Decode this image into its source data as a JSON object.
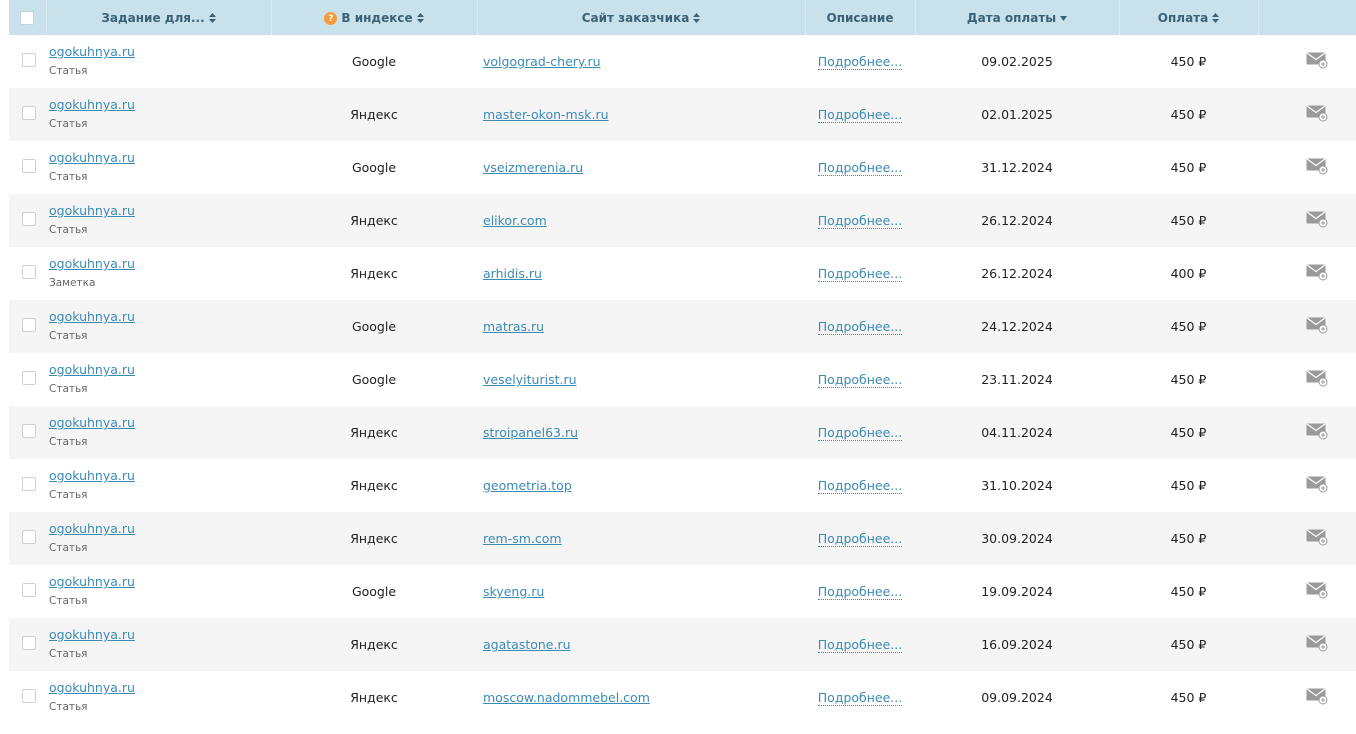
{
  "header": {
    "task": "Задание для...",
    "index": "В индексе",
    "index_help": "?",
    "site": "Сайт заказчика",
    "description": "Описание",
    "pay_date": "Дата оплаты",
    "payment": "Оплата"
  },
  "rows": [
    {
      "task": "ogokuhnya.ru",
      "type": "Статья",
      "index": "Google",
      "site": "volgograd-chery.ru",
      "desc": "Подробнее...",
      "date": "09.02.2025",
      "pay": "450 ₽"
    },
    {
      "task": "ogokuhnya.ru",
      "type": "Статья",
      "index": "Яндекс",
      "site": "master-okon-msk.ru",
      "desc": "Подробнее...",
      "date": "02.01.2025",
      "pay": "450 ₽"
    },
    {
      "task": "ogokuhnya.ru",
      "type": "Статья",
      "index": "Google",
      "site": "vseizmerenia.ru",
      "desc": "Подробнее...",
      "date": "31.12.2024",
      "pay": "450 ₽"
    },
    {
      "task": "ogokuhnya.ru",
      "type": "Статья",
      "index": "Яндекс",
      "site": "elikor.com",
      "desc": "Подробнее...",
      "date": "26.12.2024",
      "pay": "450 ₽"
    },
    {
      "task": "ogokuhnya.ru",
      "type": "Заметка",
      "index": "Яндекс",
      "site": "arhidis.ru",
      "desc": "Подробнее...",
      "date": "26.12.2024",
      "pay": "400 ₽"
    },
    {
      "task": "ogokuhnya.ru",
      "type": "Статья",
      "index": "Google",
      "site": "matras.ru",
      "desc": "Подробнее...",
      "date": "24.12.2024",
      "pay": "450 ₽"
    },
    {
      "task": "ogokuhnya.ru",
      "type": "Статья",
      "index": "Google",
      "site": "veselyiturist.ru",
      "desc": "Подробнее...",
      "date": "23.11.2024",
      "pay": "450 ₽"
    },
    {
      "task": "ogokuhnya.ru",
      "type": "Статья",
      "index": "Яндекс",
      "site": "stroipanel63.ru",
      "desc": "Подробнее...",
      "date": "04.11.2024",
      "pay": "450 ₽"
    },
    {
      "task": "ogokuhnya.ru",
      "type": "Статья",
      "index": "Яндекс",
      "site": "geometria.top",
      "desc": "Подробнее...",
      "date": "31.10.2024",
      "pay": "450 ₽"
    },
    {
      "task": "ogokuhnya.ru",
      "type": "Статья",
      "index": "Яндекс",
      "site": "rem-sm.com",
      "desc": "Подробнее...",
      "date": "30.09.2024",
      "pay": "450 ₽"
    },
    {
      "task": "ogokuhnya.ru",
      "type": "Статья",
      "index": "Google",
      "site": "skyeng.ru",
      "desc": "Подробнее...",
      "date": "19.09.2024",
      "pay": "450 ₽"
    },
    {
      "task": "ogokuhnya.ru",
      "type": "Статья",
      "index": "Яндекс",
      "site": "agatastone.ru",
      "desc": "Подробнее...",
      "date": "16.09.2024",
      "pay": "450 ₽"
    },
    {
      "task": "ogokuhnya.ru",
      "type": "Статья",
      "index": "Яндекс",
      "site": "moscow.nadommebel.com",
      "desc": "Подробнее...",
      "date": "09.09.2024",
      "pay": "450 ₽"
    }
  ],
  "icons": {
    "row_action": "mail-add-icon",
    "sort": "sort-arrows-icon",
    "help": "help-icon"
  },
  "colors": {
    "header_bg": "#c9e1ea",
    "link": "#3c8bb4",
    "help_badge": "#f29a3c"
  }
}
